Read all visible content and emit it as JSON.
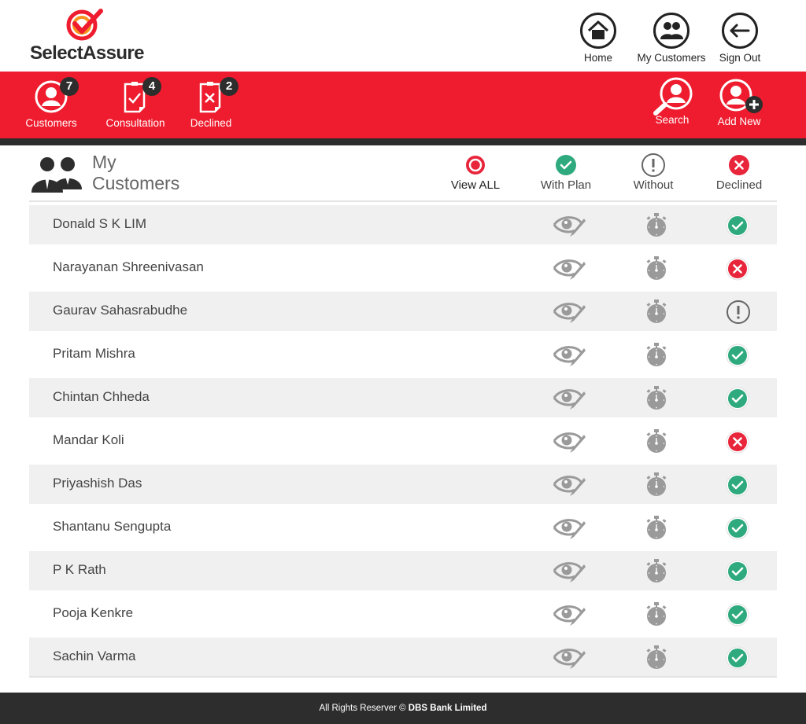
{
  "app": {
    "logo_text": "SelectAssure"
  },
  "top_nav": {
    "home": "Home",
    "my_customers": "My Customers",
    "sign_out": "Sign Out"
  },
  "red_bar": {
    "customers": {
      "label": "Customers",
      "count": "7"
    },
    "consultation": {
      "label": "Consultation",
      "count": "4"
    },
    "declined": {
      "label": "Declined",
      "count": "2"
    },
    "search": "Search",
    "add_new": "Add New"
  },
  "section": {
    "title_line1": "My",
    "title_line2": "Customers"
  },
  "filters": {
    "view_all": "View ALL",
    "with_plan": "With Plan",
    "without": "Without",
    "declined": "Declined"
  },
  "customers": [
    {
      "name": "Donald S K LIM",
      "status": "approved"
    },
    {
      "name": "Narayanan Shreenivasan",
      "status": "declined"
    },
    {
      "name": "Gaurav Sahasrabudhe",
      "status": "pending"
    },
    {
      "name": "Pritam Mishra",
      "status": "approved"
    },
    {
      "name": "Chintan Chheda",
      "status": "approved"
    },
    {
      "name": "Mandar Koli",
      "status": "declined"
    },
    {
      "name": "Priyashish Das",
      "status": "approved"
    },
    {
      "name": "Shantanu Sengupta",
      "status": "approved"
    },
    {
      "name": "P K Rath",
      "status": "approved"
    },
    {
      "name": "Pooja Kenkre",
      "status": "approved"
    },
    {
      "name": "Sachin Varma",
      "status": "approved"
    }
  ],
  "footer": {
    "prefix": "All Rights Reserver ©",
    "company": "DBS Bank Limited"
  },
  "colors": {
    "brand_red": "#ee1c2e",
    "dark": "#2d2d2d",
    "green": "#2eaa7e",
    "decline_red": "#e8253a",
    "icon_grey": "#9a9a9a"
  }
}
